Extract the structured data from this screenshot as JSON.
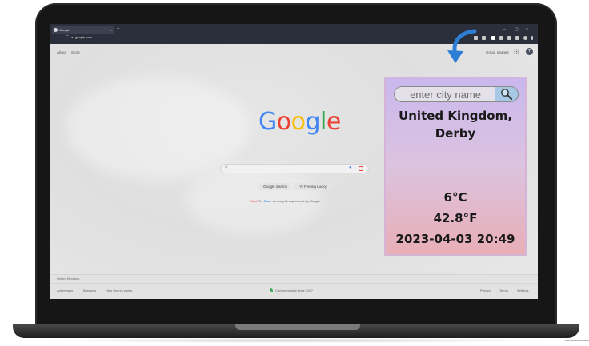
{
  "browser": {
    "tab_title": "Google",
    "tab_close": "×",
    "new_tab": "+",
    "url": "google.com",
    "window_controls": [
      "⌄",
      "–",
      "▢",
      "×"
    ],
    "nav": [
      "←",
      "→",
      "C"
    ]
  },
  "google": {
    "top_left_links": [
      "About",
      "Store"
    ],
    "top_right_links": [
      "Gmail",
      "Images"
    ],
    "profile_initial": "T",
    "logo_letters": [
      "G",
      "o",
      "o",
      "g",
      "l",
      "e"
    ],
    "buttons": [
      "Google Search",
      "I'm Feeling Lucky"
    ],
    "bard_new": "New!",
    "bard_try": "Try",
    "bard_link": "Bard",
    "bard_rest": ", an early AI experiment by Google",
    "footer_country": "United Kingdom",
    "footer_left": [
      "Advertising",
      "Business",
      "How Search works"
    ],
    "footer_center": "Carbon neutral since 2007",
    "footer_right": [
      "Privacy",
      "Terms",
      "Settings"
    ]
  },
  "weather": {
    "placeholder": "enter city name",
    "location_line1": "United Kingdom,",
    "location_line2": "Derby",
    "condition_icon": "moon-icon",
    "temp_c": "6°C",
    "temp_f": "42.8°F",
    "datetime": "2023-04-03 20:49"
  },
  "colors": {
    "google_blue": "#4285f4",
    "google_red": "#ea4335",
    "google_yellow": "#fbbc05",
    "google_green": "#34a853",
    "moon": "#1f4fc4",
    "arrow": "#2d7fd6"
  }
}
